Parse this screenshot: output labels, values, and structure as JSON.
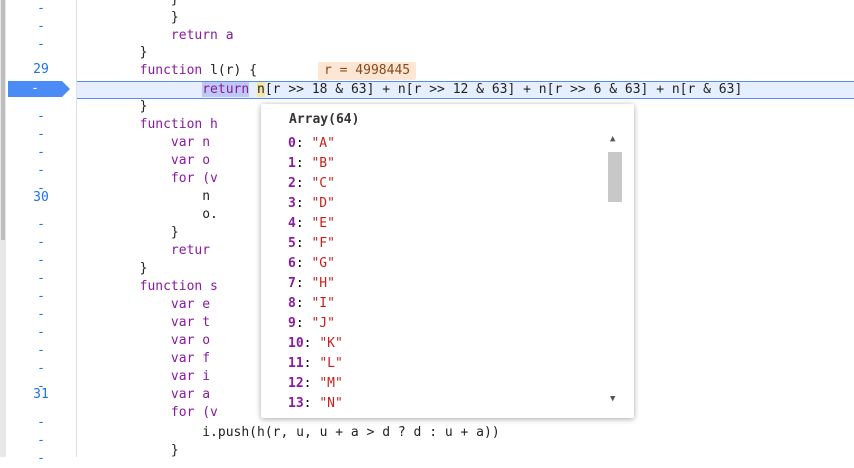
{
  "gutter": [
    {
      "label": "-"
    },
    {
      "label": "-"
    },
    {
      "label": "-"
    },
    {
      "label": "29"
    },
    {
      "label": "-"
    },
    {
      "label": "-"
    },
    {
      "label": "-"
    },
    {
      "label": "-"
    },
    {
      "label": "-"
    },
    {
      "label": "-"
    },
    {
      "label": "30"
    },
    {
      "label": "-"
    },
    {
      "label": "-"
    },
    {
      "label": "-"
    },
    {
      "label": "-"
    },
    {
      "label": "-"
    },
    {
      "label": "-"
    },
    {
      "label": "-"
    },
    {
      "label": "-"
    },
    {
      "label": "-"
    },
    {
      "label": "-"
    },
    {
      "label": "31"
    },
    {
      "label": "-"
    },
    {
      "label": "-"
    },
    {
      "label": "-"
    }
  ],
  "breakpoint_label": "-",
  "code": {
    "l0": "            }",
    "l1": "            }",
    "l2": "            return a",
    "l3": "        }",
    "l4_pre": "        function ",
    "l4_name": "l(r) {",
    "l5_return": "return",
    "l5_n": "n",
    "l5_rest": "[r >> 18 & 63] + n[r >> 12 & 63] + n[r >> 6 & 63] + n[r & 63]",
    "l6": "        }",
    "l7": "        function h",
    "l8": "            var n",
    "l9": "            var o",
    "l10": "            for (v",
    "l11": "                n",
    "l12": "                o.",
    "l13": "            }",
    "l14": "            retur",
    "l15": "        }",
    "l16": "        function s",
    "l17": "            var e",
    "l18": "            var t",
    "l19": "            var o",
    "l20": "            var f",
    "l21": "            var i",
    "l22": "            var a",
    "l23": "            for (v",
    "l24": "                i.push(h(r, u, u + a > d ? d : u + a))",
    "l25": "            }"
  },
  "inline_hint": "r = 4998445",
  "popover": {
    "title": "Array(64)",
    "items": [
      {
        "k": "0",
        "v": "\"A\""
      },
      {
        "k": "1",
        "v": "\"B\""
      },
      {
        "k": "2",
        "v": "\"C\""
      },
      {
        "k": "3",
        "v": "\"D\""
      },
      {
        "k": "4",
        "v": "\"E\""
      },
      {
        "k": "5",
        "v": "\"F\""
      },
      {
        "k": "6",
        "v": "\"G\""
      },
      {
        "k": "7",
        "v": "\"H\""
      },
      {
        "k": "8",
        "v": "\"I\""
      },
      {
        "k": "9",
        "v": "\"J\""
      },
      {
        "k": "10",
        "v": "\"K\""
      },
      {
        "k": "11",
        "v": "\"L\""
      },
      {
        "k": "12",
        "v": "\"M\""
      },
      {
        "k": "13",
        "v": "\"N\""
      }
    ],
    "scroll_up": "▲",
    "scroll_down": "▼"
  }
}
